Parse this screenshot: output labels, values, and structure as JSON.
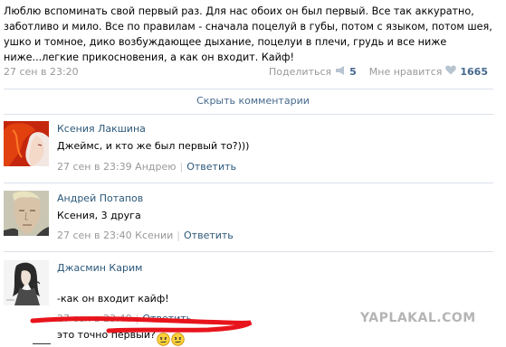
{
  "post": {
    "text": "Люблю вспоминать свой первый раз. Для нас обоих он был первый. Все так аккуратно, заботливо и мило. Все по правилам - сначала поцелуй в губы, потом с языком, потом шея, ушко и томное, дико возбуждающее дыхание, поцелуи в плечи, грудь и все ниже ниже...легкие прикосновения, а как он входит. Кайф!",
    "date": "27 сен в 23:20",
    "share_label": "Поделиться",
    "share_count": "5",
    "like_label": "Мне нравится",
    "like_count": "1665",
    "share_icon": "megaphone-icon",
    "like_icon": "heart-icon"
  },
  "hide_comments_label": "Скрыть комментарии",
  "comments": [
    {
      "author": "Ксения Лакшина",
      "text": "Джеймс, и кто же был первый то?)))",
      "date": "27 сен в 23:39 Андрею",
      "reply_label": "Ответить"
    },
    {
      "author": "Андрей Потапов",
      "text": "Ксения, 3 друга",
      "date": "27 сен в 23:40 Ксении",
      "reply_label": "Ответить"
    },
    {
      "author": "Джасмин Карим",
      "text_line1": "-как он входит кайф!",
      "text_line2": "это точно первый?",
      "date": "27 сен в 23:40",
      "reply_label": "Ответить"
    }
  ],
  "watermark": "YAPLAKAL.COM",
  "colors": {
    "link": "#2b587a",
    "meta": "#999999",
    "divider": "#dae1e8",
    "annotation": "#e8141c"
  }
}
